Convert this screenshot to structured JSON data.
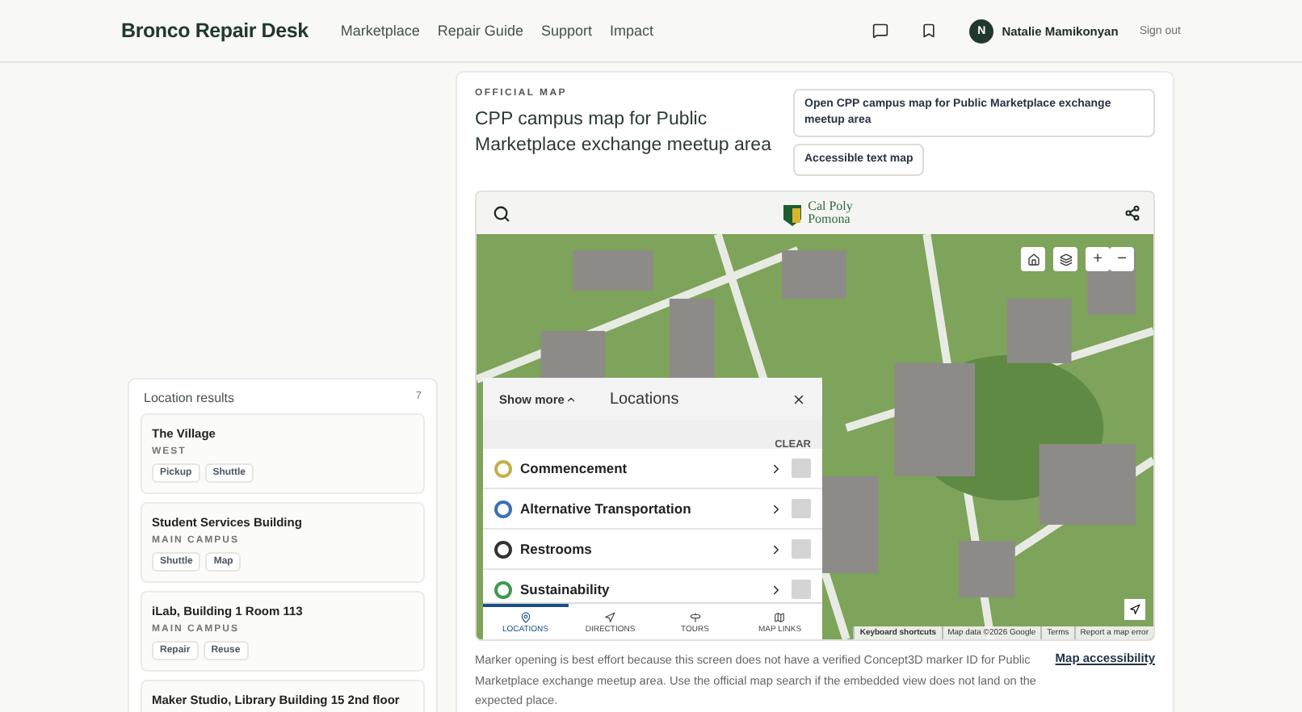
{
  "header": {
    "brand": "Bronco Repair Desk",
    "nav": [
      {
        "label": "Marketplace"
      },
      {
        "label": "Repair Guide"
      },
      {
        "label": "Support"
      },
      {
        "label": "Impact"
      }
    ],
    "user": {
      "initial": "N",
      "name": "Natalie Mamikonyan"
    },
    "sign_out": "Sign out"
  },
  "results": {
    "title": "Location results",
    "count": "7",
    "items": [
      {
        "name": "The Village",
        "area": "WEST",
        "tags": [
          "Pickup",
          "Shuttle"
        ]
      },
      {
        "name": "Student Services Building",
        "area": "MAIN CAMPUS",
        "tags": [
          "Shuttle",
          "Map"
        ]
      },
      {
        "name": "iLab, Building 1 Room 113",
        "area": "MAIN CAMPUS",
        "tags": [
          "Repair",
          "Reuse"
        ]
      },
      {
        "name": "Maker Studio, Library Building 15 2nd floor"
      }
    ]
  },
  "map_card": {
    "eyebrow": "OFFICIAL MAP",
    "title": "CPP campus map for Public Marketplace exchange meetup area",
    "actions": [
      "Open CPP campus map for Public Marketplace exchange meetup area",
      "Accessible text map"
    ],
    "map": {
      "logo": [
        "Cal Poly",
        "Pomona"
      ],
      "zoom_in": "+",
      "zoom_out": "−",
      "panel": {
        "show_more": "Show more",
        "title": "Locations",
        "clear": "CLEAR",
        "categories": [
          {
            "label": "Commencement",
            "color": "#c2b04e",
            "checked": false
          },
          {
            "label": "Alternative Transportation",
            "color": "#3b6fb6",
            "checked": false
          },
          {
            "label": "Restrooms",
            "color": "#333333",
            "checked": false
          },
          {
            "label": "Sustainability",
            "color": "#3a9a4a",
            "checked": false
          }
        ],
        "tabs": [
          {
            "label": "LOCATIONS",
            "kind": "pin",
            "selected": true
          },
          {
            "label": "DIRECTIONS",
            "kind": "directions",
            "selected": false
          },
          {
            "label": "TOURS",
            "kind": "signpost",
            "selected": false
          },
          {
            "label": "MAP LINKS",
            "kind": "map",
            "selected": false
          }
        ]
      },
      "attribution": [
        "Keyboard shortcuts",
        "Map data ©2026 Google",
        "Terms",
        "Report a map error"
      ]
    },
    "note": "Marker opening is best effort because this screen does not have a verified Concept3D marker ID for Public Marketplace exchange meetup area. Use the official map search if the embedded view does not land on the expected place.",
    "note_link": "Map accessibility"
  }
}
